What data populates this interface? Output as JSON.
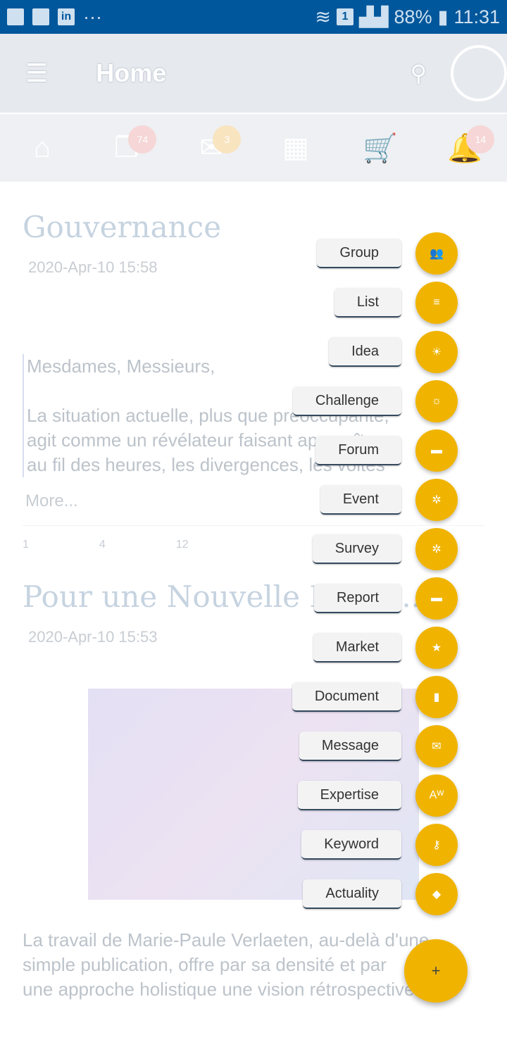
{
  "status": {
    "battery": "88%",
    "time": "11:31",
    "sim": "1"
  },
  "appbar": {
    "title": "Home"
  },
  "tabs": [
    {
      "icon": "home-icon"
    },
    {
      "icon": "copy-icon",
      "badge": "74"
    },
    {
      "icon": "mail-icon",
      "badge": "3"
    },
    {
      "icon": "calendar-icon"
    },
    {
      "icon": "cart-icon"
    },
    {
      "icon": "bell-icon",
      "badge": "14"
    }
  ],
  "posts": [
    {
      "title": "Gouvernance",
      "date": "2020-Apr-10 15:58",
      "body": [
        "Mesdames, Messieurs,",
        "La situation actuelle, plus que préoccupante,",
        "agit comme un révélateur faisant apparaître,",
        "au fil des heures, les divergences, les voltes"
      ],
      "more": "More...",
      "likes": "1",
      "comments": "4",
      "views": "12"
    },
    {
      "title": "Pour une Nouvelle Econo...",
      "date": "2020-Apr-10 15:53",
      "body": [
        "La travail de Marie-Paule Verlaeten, au-delà d'une",
        "simple publication, offre par sa densité et par",
        "une approche holistique une vision rétrospective"
      ]
    }
  ],
  "speed_dial": [
    {
      "label": "Group",
      "icon": "group-icon",
      "glyph": "👥"
    },
    {
      "label": "List",
      "icon": "list-icon",
      "glyph": "≡"
    },
    {
      "label": "Idea",
      "icon": "lightbulb-icon",
      "glyph": "☀"
    },
    {
      "label": "Challenge",
      "icon": "sun-icon",
      "glyph": "☼"
    },
    {
      "label": "Forum",
      "icon": "forum-icon",
      "glyph": "▬"
    },
    {
      "label": "Event",
      "icon": "gear-icon",
      "glyph": "✲"
    },
    {
      "label": "Survey",
      "icon": "gear-icon",
      "glyph": "✲"
    },
    {
      "label": "Report",
      "icon": "folder-icon",
      "glyph": "▬"
    },
    {
      "label": "Market",
      "icon": "star-icon",
      "glyph": "★"
    },
    {
      "label": "Document",
      "icon": "document-icon",
      "glyph": "▮"
    },
    {
      "label": "Message",
      "icon": "envelope-open-icon",
      "glyph": "✉"
    },
    {
      "label": "Expertise",
      "icon": "expertise-icon",
      "glyph": "Aᵂ"
    },
    {
      "label": "Keyword",
      "icon": "key-icon",
      "glyph": "⚷"
    },
    {
      "label": "Actuality",
      "icon": "megaphone-icon",
      "glyph": "◆"
    }
  ],
  "main_fab": {
    "glyph": "+"
  }
}
